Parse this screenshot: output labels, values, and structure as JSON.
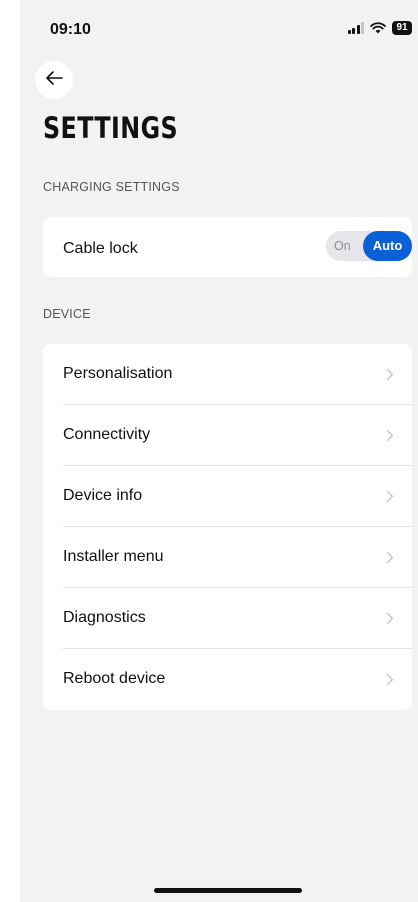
{
  "status_bar": {
    "time": "09:10",
    "battery": "91",
    "icons": [
      "signal-icon",
      "wifi-icon",
      "battery-icon"
    ]
  },
  "header": {
    "back_icon": "arrow-left-icon",
    "title": "SETTINGS"
  },
  "charging": {
    "section_label": "CHARGING SETTINGS",
    "cable_lock": {
      "label": "Cable lock",
      "options": [
        "On",
        "Auto"
      ],
      "selected": "Auto"
    }
  },
  "device": {
    "section_label": "DEVICE",
    "items": [
      {
        "label": "Personalisation"
      },
      {
        "label": "Connectivity"
      },
      {
        "label": "Device info"
      },
      {
        "label": "Installer menu"
      },
      {
        "label": "Diagnostics"
      },
      {
        "label": "Reboot device"
      }
    ]
  },
  "colors": {
    "accent": "#0b5fd7",
    "background": "#f2f2f4",
    "card": "#ffffff"
  }
}
